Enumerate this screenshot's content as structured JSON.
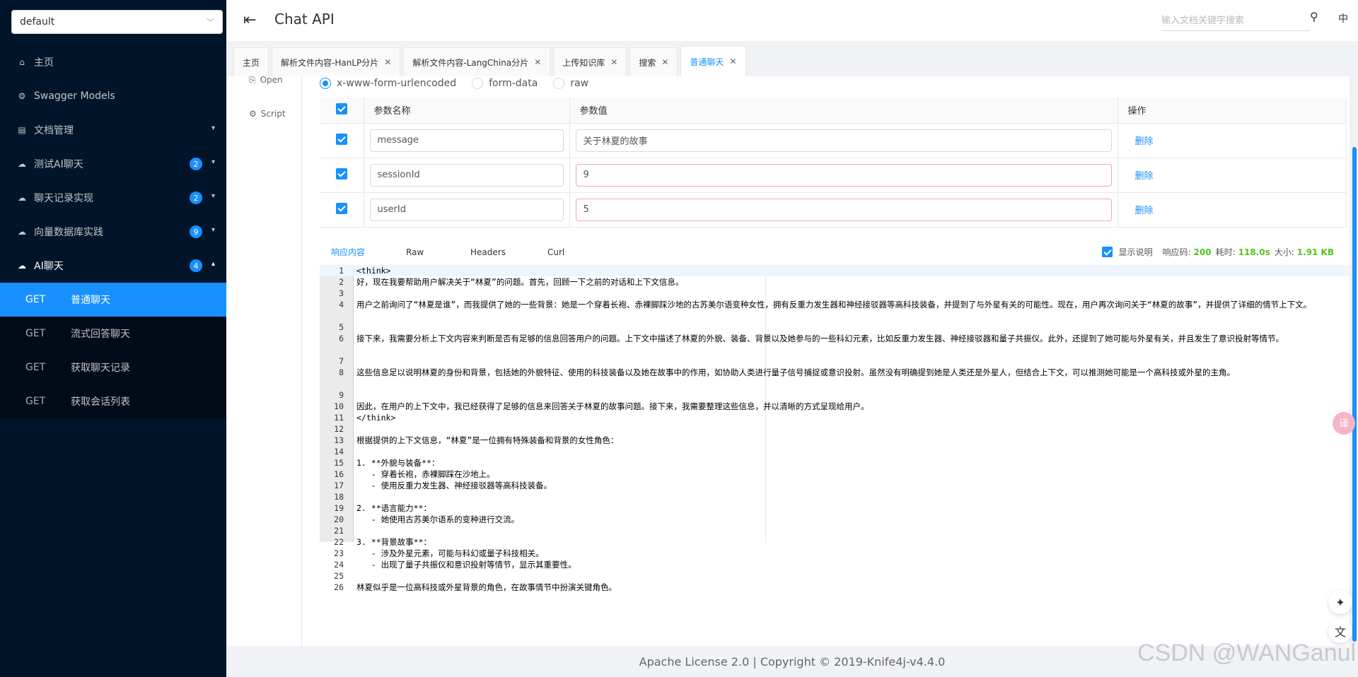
{
  "group_select": {
    "value": "default"
  },
  "sidebar": {
    "items": [
      {
        "label": "主页",
        "icon": "home-icon"
      },
      {
        "label": "Swagger Models",
        "icon": "gear-icon"
      },
      {
        "label": "文档管理",
        "icon": "doc-icon"
      },
      {
        "label": "测试AI聊天",
        "icon": "cloud-icon",
        "badge": "2"
      },
      {
        "label": "聊天记录实现",
        "icon": "cloud-icon",
        "badge": "2"
      },
      {
        "label": "向量数据库实践",
        "icon": "cloud-icon",
        "badge": "9"
      },
      {
        "label": "AI聊天",
        "icon": "cloud-icon",
        "badge": "4"
      }
    ],
    "subitems": [
      {
        "method": "GET",
        "label": "普通聊天"
      },
      {
        "method": "GET",
        "label": "流式回答聊天"
      },
      {
        "method": "GET",
        "label": "获取聊天记录"
      },
      {
        "method": "GET",
        "label": "获取会话列表"
      }
    ]
  },
  "header": {
    "title": "Chat API",
    "search_placeholder": "输入文档关键字搜索",
    "lang": "中"
  },
  "tabs": [
    {
      "label": "主页"
    },
    {
      "label": "解析文件内容-HanLP分片"
    },
    {
      "label": "解析文件内容-LangChina分片"
    },
    {
      "label": "上传知识库"
    },
    {
      "label": "搜索"
    },
    {
      "label": "普通聊天"
    }
  ],
  "side_actions": {
    "open": "Open",
    "script": "Script"
  },
  "content_types": [
    "x-www-form-urlencoded",
    "form-data",
    "raw"
  ],
  "params_table": {
    "headers": [
      "参数名称",
      "参数值",
      "操作"
    ],
    "rows": [
      {
        "name": "message",
        "value": "关于林夏的故事",
        "action": "删除"
      },
      {
        "name": "sessionId",
        "value": "9",
        "action": "删除"
      },
      {
        "name": "userId",
        "value": "5",
        "action": "删除"
      }
    ]
  },
  "response": {
    "tabs": [
      "响应内容",
      "Raw",
      "Headers",
      "Curl"
    ],
    "show_desc": "显示说明",
    "status_label": "响应码:",
    "status": "200",
    "time_label": "耗时:",
    "time": "118.0s",
    "size_label": "大小:",
    "size": "1.91 KB",
    "lines": [
      "<think>",
      "好，现在我要帮助用户解决关于“林夏”的问题。首先，回顾一下之前的对话和上下文信息。",
      "",
      "用户之前询问了“林夏是谁”，而我提供了她的一些背景：她是一个穿着长袍、赤裸脚踩沙地的古苏美尔语变种女性，拥有反重力发生器和神经接驳器等高科技装备，并提到了与外星有关的可能性。现在，用户再次询问关于“林夏的故事”，并提供了详细的情节上下文。",
      "",
      "接下来，我需要分析上下文内容来判断是否有足够的信息回答用户的问题。上下文中描述了林夏的外貌、装备、背景以及她参与的一些科幻元素，比如反重力发生器、神经接驳器和量子共振仪。此外，还提到了她可能与外星有关，并且发生了意识投射等情节。",
      "",
      "这些信息足以说明林夏的身份和背景，包括她的外貌特征、使用的科技装备以及她在故事中的作用，如协助人类进行量子信号捕捉或意识投射。虽然没有明确提到她是人类还是外星人，但结合上下文，可以推测她可能是一个高科技或外星的主角。",
      "",
      "因此，在用户的上下文中，我已经获得了足够的信息来回答关于林夏的故事问题。接下来，我需要整理这些信息，并以清晰的方式呈现给用户。",
      "</think>",
      "",
      "根据提供的上下文信息，“林夏”是一位拥有特殊装备和背景的女性角色：",
      "",
      "1. **外貌与装备**：",
      "   - 穿着长袍，赤裸脚踩在沙地上。",
      "   - 使用反重力发生器、神经接驳器等高科技装备。",
      "",
      "2. **语言能力**：",
      "   - 她使用古苏美尔语系的变种进行交流。",
      "",
      "3. **背景故事**：",
      "   - 涉及外星元素，可能与科幻或量子科技相关。",
      "   - 出现了量子共振仪和意识投射等情节，显示其重要性。",
      "",
      "林夏似乎是一位高科技或外星背景的角色，在故事情节中扮演关键角色。"
    ]
  },
  "footer": {
    "text": "Apache License 2.0 | Copyright © 2019-Knife4j-v4.4.0"
  },
  "watermark": "CSDN @WANGanul"
}
